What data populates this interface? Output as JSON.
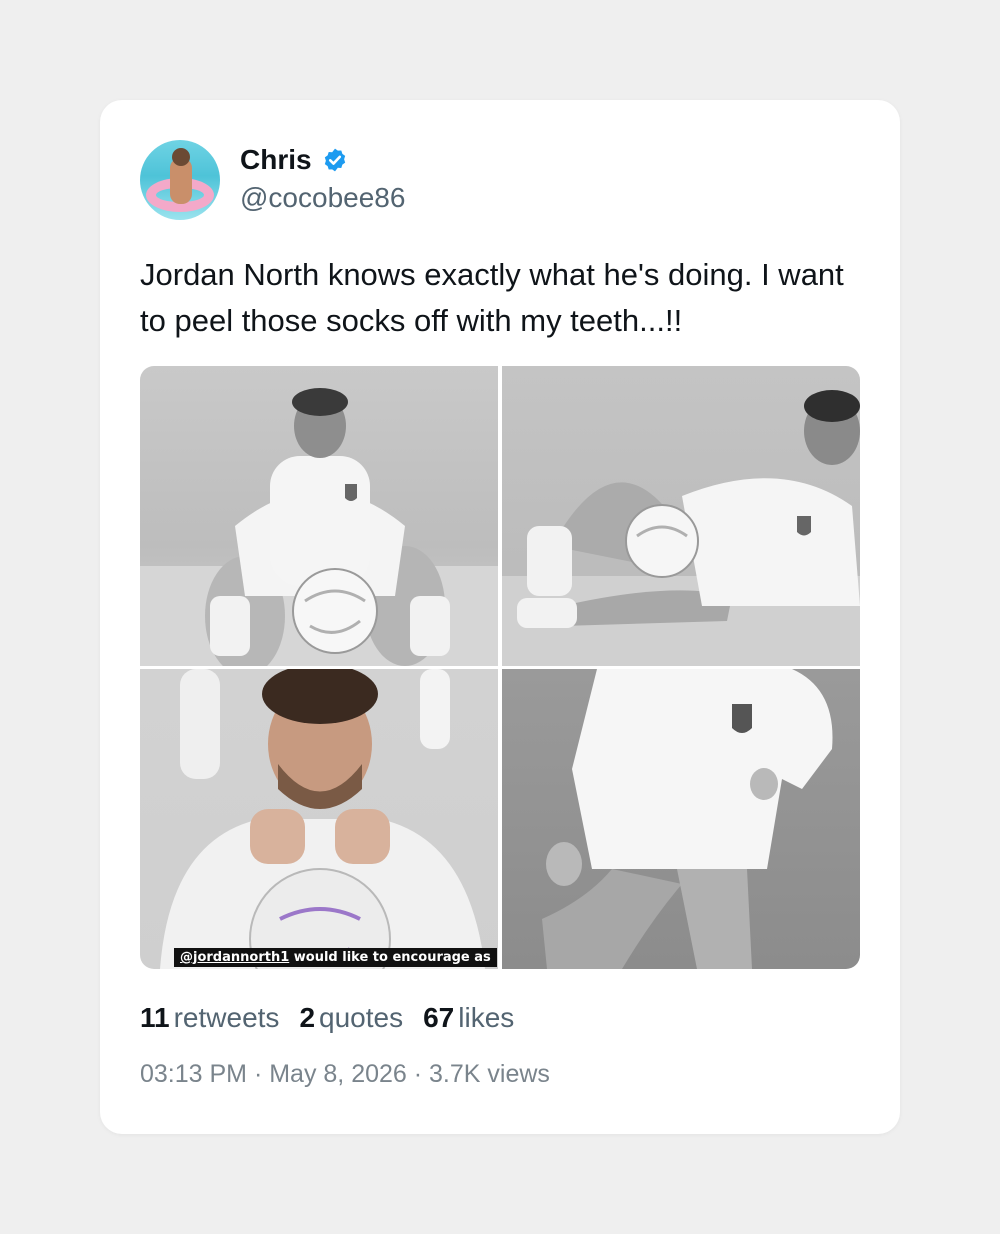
{
  "tweet": {
    "author": {
      "name": "Chris",
      "handle": "@cocobee86",
      "verified": true,
      "avatar_icon": "avatar-pool-float-photo"
    },
    "text": "Jordan North knows exactly what he's doing. I want to peel those socks off with my teeth...!!",
    "images": [
      {
        "label": "photo-sitting-with-ball"
      },
      {
        "label": "photo-reclining-with-ball"
      },
      {
        "label": "photo-chin-on-fists",
        "caption_tag": "@jordannorth1",
        "caption_text": " would like to encourage as"
      },
      {
        "label": "photo-standing-hand-on-hip"
      }
    ],
    "stats": {
      "retweets_count": "11",
      "retweets_label": "retweets",
      "quotes_count": "2",
      "quotes_label": "quotes",
      "likes_count": "67",
      "likes_label": "likes"
    },
    "meta": "03:13 PM · May 8, 2026 · 3.7K views"
  },
  "colors": {
    "background": "#efefef",
    "card": "#ffffff",
    "verified": "#1d9bf0",
    "secondary_text": "#536471"
  }
}
